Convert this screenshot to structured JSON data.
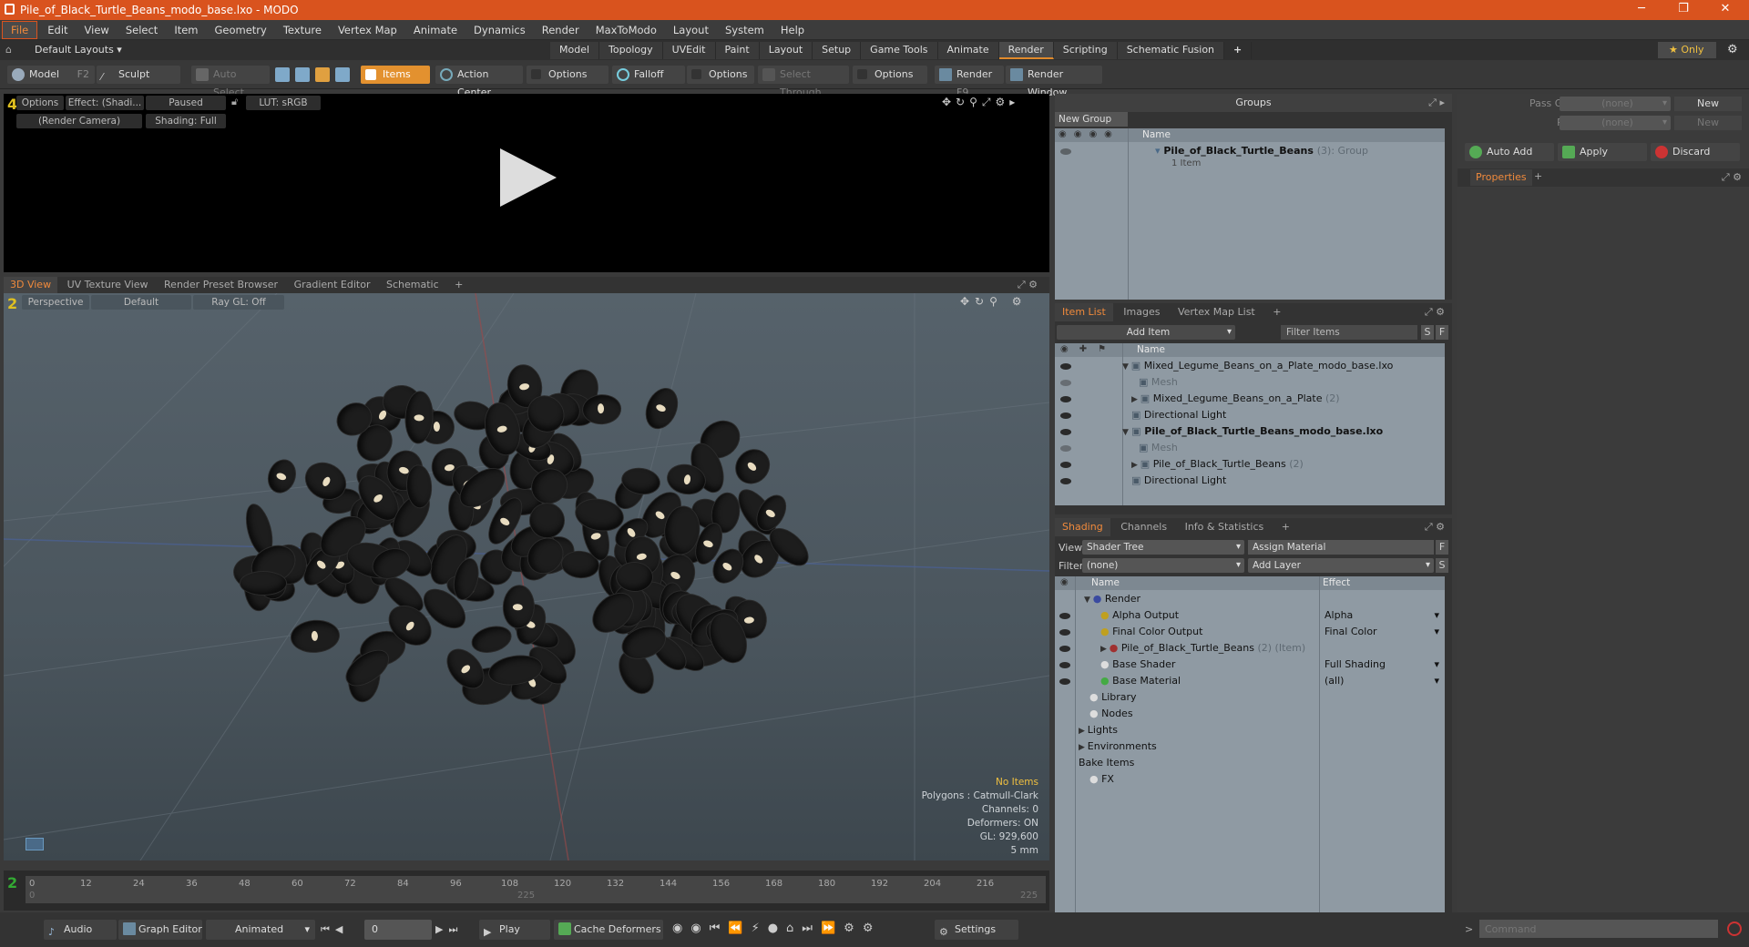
{
  "window": {
    "title": "Pile_of_Black_Turtle_Beans_modo_base.lxo - MODO",
    "minimize": "─",
    "restore": "❐",
    "close": "✕"
  },
  "menu": [
    "File",
    "Edit",
    "View",
    "Select",
    "Item",
    "Geometry",
    "Texture",
    "Vertex Map",
    "Animate",
    "Dynamics",
    "Render",
    "MaxToModo",
    "Layout",
    "System",
    "Help"
  ],
  "layout": {
    "label": "Default Layouts ▾",
    "tabs": [
      "Model",
      "Topology",
      "UVEdit",
      "Paint",
      "Layout",
      "Setup",
      "Game Tools",
      "Animate",
      "Render",
      "Scripting",
      "Schematic Fusion"
    ],
    "active": "Render",
    "add": "+",
    "only": "Only"
  },
  "toolbar": {
    "model": "Model",
    "model_key": "F2",
    "sculpt": "Sculpt",
    "auto_select": "Auto Select",
    "items": "Items",
    "action_center": "Action Center",
    "options1": "Options",
    "falloff": "Falloff",
    "options2": "Options",
    "select_through": "Select Through",
    "options3": "Options",
    "render": "Render",
    "render_key": "F9",
    "render_window": "Render Window"
  },
  "render_view": {
    "num": "4",
    "options": "Options",
    "effect": "Effect: (Shadi...",
    "paused": "Paused",
    "lut": "LUT: sRGB",
    "camera": "(Render Camera)",
    "shading": "Shading: Full"
  },
  "view_tabs": [
    "3D View",
    "UV Texture View",
    "Render Preset Browser",
    "Gradient Editor",
    "Schematic",
    "+"
  ],
  "view3d": {
    "num": "2",
    "perspective": "Perspective",
    "default": "Default",
    "raygl": "Ray GL: Off",
    "info": {
      "no_items": "No Items",
      "polygons": "Polygons : Catmull-Clark",
      "channels": "Channels: 0",
      "deformers": "Deformers: ON",
      "gl": "GL: 929,600",
      "scale": "5 mm"
    }
  },
  "timeline": {
    "ticks": [
      "0",
      "12",
      "24",
      "36",
      "48",
      "60",
      "72",
      "84",
      "96",
      "108",
      "120",
      "132",
      "144",
      "156",
      "168",
      "180",
      "192",
      "204",
      "216"
    ],
    "start": "0",
    "mid": "225",
    "end": "225"
  },
  "bottom": {
    "audio": "Audio",
    "graph_editor": "Graph Editor",
    "animated": "Animated",
    "frame": "0",
    "play": "Play",
    "cache": "Cache Deformers",
    "settings": "Settings",
    "command_placeholder": "Command"
  },
  "groups": {
    "title": "Groups",
    "new_group": "New Group",
    "col_name": "Name",
    "item_name": "Pile_of_Black_Turtle_Beans",
    "item_count": "(3)",
    "item_type": ": Group",
    "item_sub": "1 Item"
  },
  "passes": {
    "pass_groups": "Pass Groups",
    "passes": "Passes",
    "none1": "(none)",
    "none2": "(none)",
    "new1": "New",
    "new2": "New",
    "auto_add": "Auto Add",
    "apply": "Apply",
    "discard": "Discard",
    "properties": "Properties",
    "add": "+"
  },
  "item_list": {
    "tabs": [
      "Item List",
      "Images",
      "Vertex Map List",
      "+"
    ],
    "add_item": "Add Item",
    "filter": "Filter Items",
    "s": "S",
    "f": "F",
    "col_name": "Name",
    "rows": [
      {
        "label": "Mixed_Legume_Beans_on_a_Plate_modo_base.lxo",
        "bold": false,
        "dim": false,
        "count": ""
      },
      {
        "label": "Mesh",
        "bold": false,
        "dim": true,
        "count": ""
      },
      {
        "label": "Mixed_Legume_Beans_on_a_Plate",
        "bold": false,
        "dim": false,
        "count": "(2)"
      },
      {
        "label": "Directional Light",
        "bold": false,
        "dim": false,
        "count": ""
      },
      {
        "label": "Pile_of_Black_Turtle_Beans_modo_base.lxo",
        "bold": true,
        "dim": false,
        "count": ""
      },
      {
        "label": "Mesh",
        "bold": false,
        "dim": true,
        "count": ""
      },
      {
        "label": "Pile_of_Black_Turtle_Beans",
        "bold": false,
        "dim": false,
        "count": "(2)"
      },
      {
        "label": "Directional Light",
        "bold": false,
        "dim": false,
        "count": ""
      }
    ]
  },
  "shading": {
    "tabs": [
      "Shading",
      "Channels",
      "Info & Statistics",
      "+"
    ],
    "view_label": "View",
    "view_value": "Shader Tree",
    "assign": "Assign Material",
    "f": "F",
    "filter_label": "Filter",
    "filter_value": "(none)",
    "add_layer": "Add Layer",
    "s": "S",
    "col_name": "Name",
    "col_effect": "Effect",
    "rows": [
      {
        "label": "Render",
        "effect": ""
      },
      {
        "label": "Alpha Output",
        "effect": "Alpha"
      },
      {
        "label": "Final Color Output",
        "effect": "Final Color"
      },
      {
        "label": "Pile_of_Black_Turtle_Beans",
        "extra": "(2) (Item)",
        "effect": ""
      },
      {
        "label": "Base Shader",
        "effect": "Full Shading"
      },
      {
        "label": "Base Material",
        "effect": "(all)"
      },
      {
        "label": "Library",
        "effect": ""
      },
      {
        "label": "Nodes",
        "effect": ""
      },
      {
        "label": "Lights",
        "effect": ""
      },
      {
        "label": "Environments",
        "effect": ""
      },
      {
        "label": "Bake Items",
        "effect": ""
      },
      {
        "label": "FX",
        "effect": ""
      }
    ]
  }
}
